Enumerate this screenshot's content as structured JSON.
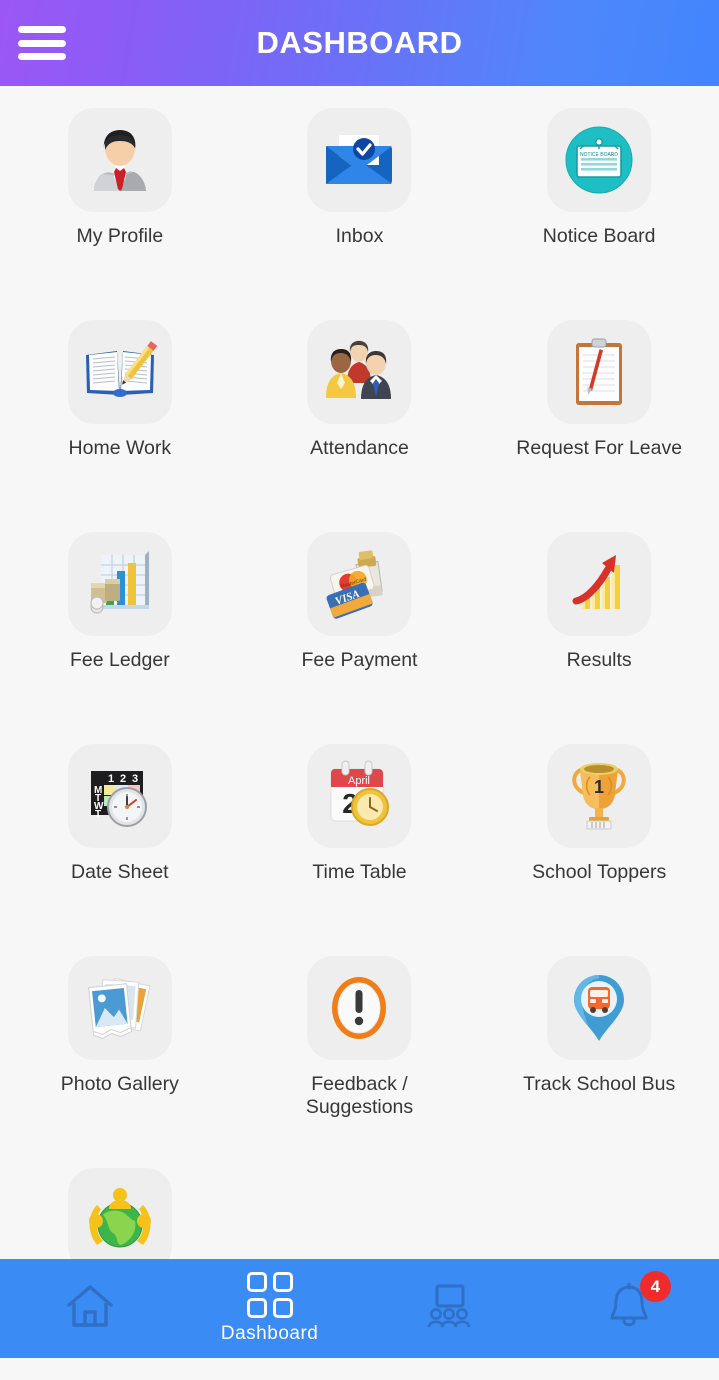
{
  "header": {
    "title": "DASHBOARD",
    "menu_icon": "hamburger-menu-icon",
    "gradient_start": "#9b57f5",
    "gradient_end": "#4285fd"
  },
  "grid": {
    "items": [
      {
        "label": "My Profile",
        "icon": "user-profile-icon"
      },
      {
        "label": "Inbox",
        "icon": "envelope-check-icon"
      },
      {
        "label": "Notice Board",
        "icon": "notice-board-clipboard-icon",
        "icon_text": "NOTICE BOARD"
      },
      {
        "label": "Home Work",
        "icon": "open-book-pencil-icon"
      },
      {
        "label": "Attendance",
        "icon": "people-group-icon"
      },
      {
        "label": "Request For Leave",
        "icon": "clipboard-pen-icon"
      },
      {
        "label": "Fee Ledger",
        "icon": "bar-chart-money-icon"
      },
      {
        "label": "Fee Payment",
        "icon": "credit-cards-icon",
        "icon_text": "VISA"
      },
      {
        "label": "Results",
        "icon": "growth-chart-arrow-icon"
      },
      {
        "label": "Date Sheet",
        "icon": "schedule-clock-icon",
        "icon_text": "1 2 3 M T W T"
      },
      {
        "label": "Time Table",
        "icon": "calendar-clock-icon",
        "icon_text": "April 2"
      },
      {
        "label": "School Toppers",
        "icon": "trophy-icon",
        "icon_text": "1"
      },
      {
        "label": "Photo Gallery",
        "icon": "photo-stack-icon"
      },
      {
        "label": "Feedback / Suggestions",
        "icon": "exclamation-circle-icon"
      },
      {
        "label": "Track School Bus",
        "icon": "bus-map-pin-icon"
      },
      {
        "label": "",
        "icon": "globe-community-icon"
      }
    ]
  },
  "bottom_nav": {
    "items": [
      {
        "label": "",
        "icon": "home-icon",
        "active": false,
        "badge": ""
      },
      {
        "label": "Dashboard",
        "icon": "grid-squares-icon",
        "active": true,
        "badge": ""
      },
      {
        "label": "",
        "icon": "classroom-icon",
        "active": false,
        "badge": ""
      },
      {
        "label": "",
        "icon": "bell-icon",
        "active": false,
        "badge": "4"
      }
    ],
    "background": "#3b8bf5",
    "badge_color": "#ef2b2b"
  }
}
